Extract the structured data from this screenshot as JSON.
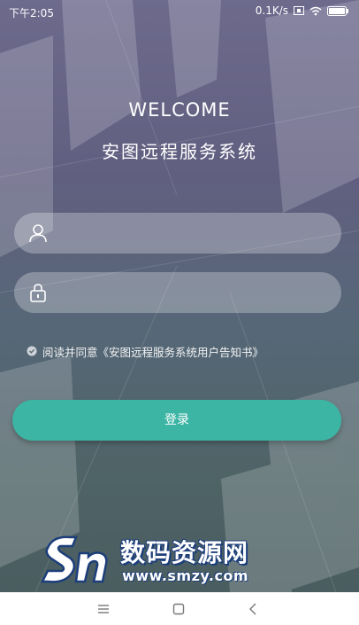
{
  "status_bar": {
    "time": "下午2:05",
    "net_speed": "0.1K/s"
  },
  "header": {
    "welcome": "WELCOME",
    "subtitle": "安图远程服务系统"
  },
  "form": {
    "username": {
      "value": "",
      "placeholder": ""
    },
    "password": {
      "value": "",
      "placeholder": ""
    },
    "agreement": "阅读并同意《安图远程服务系统用户告知书》",
    "login_label": "登录"
  },
  "watermark": {
    "title": "数码资源网",
    "url": "www.smzy.com"
  },
  "colors": {
    "accent": "#3cb5a4",
    "background_top": "#6d6a8c",
    "background_bottom": "#4a5d60"
  },
  "icons": {
    "user_field": "user-icon",
    "password_field": "lock-icon",
    "agreement": "check-circle-icon",
    "nav": [
      "menu-icon",
      "home-square-icon",
      "back-chevron-icon"
    ]
  }
}
